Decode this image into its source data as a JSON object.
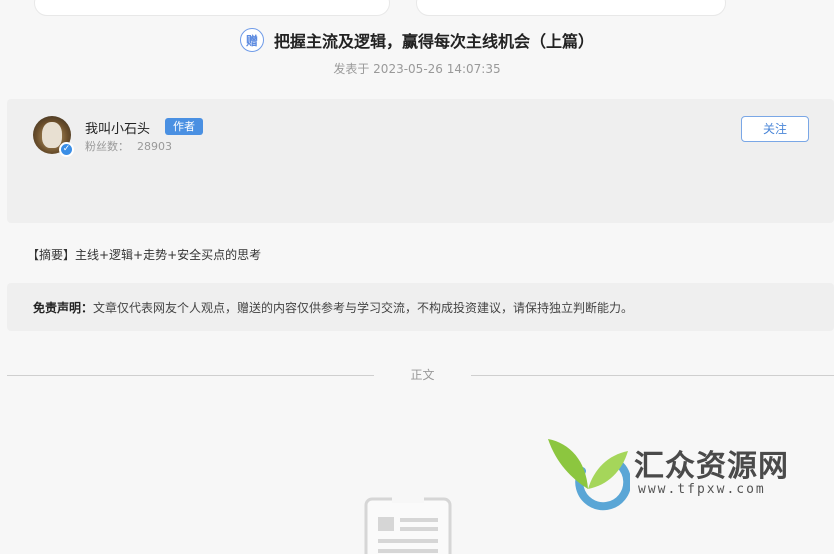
{
  "article": {
    "gift_badge": "赠",
    "title": "把握主流及逻辑，赢得每次主线机会（上篇）",
    "publish_time": "发表于 2023-05-26 14:07:35"
  },
  "author": {
    "name": "我叫小石头",
    "badge": "作者",
    "fans_label": "粉丝数：",
    "fans_count": "28903",
    "follow_label": "关注",
    "verified_mark": "✓"
  },
  "summary": "【摘要】主线+逻辑+走势+安全买点的思考",
  "disclaimer": {
    "label": "免责声明：",
    "text": "文章仅代表网友个人观点，赠送的内容仅供参考与学习交流，不构成投资建议，请保持独立判断能力。"
  },
  "divider": {
    "label": "正文"
  },
  "watermark": {
    "name": "汇众资源网",
    "url": "www.tfpxw.com"
  },
  "colors": {
    "accent": "#4a90e2",
    "card_bg": "#efefef",
    "page_bg": "#f7f7f7"
  }
}
